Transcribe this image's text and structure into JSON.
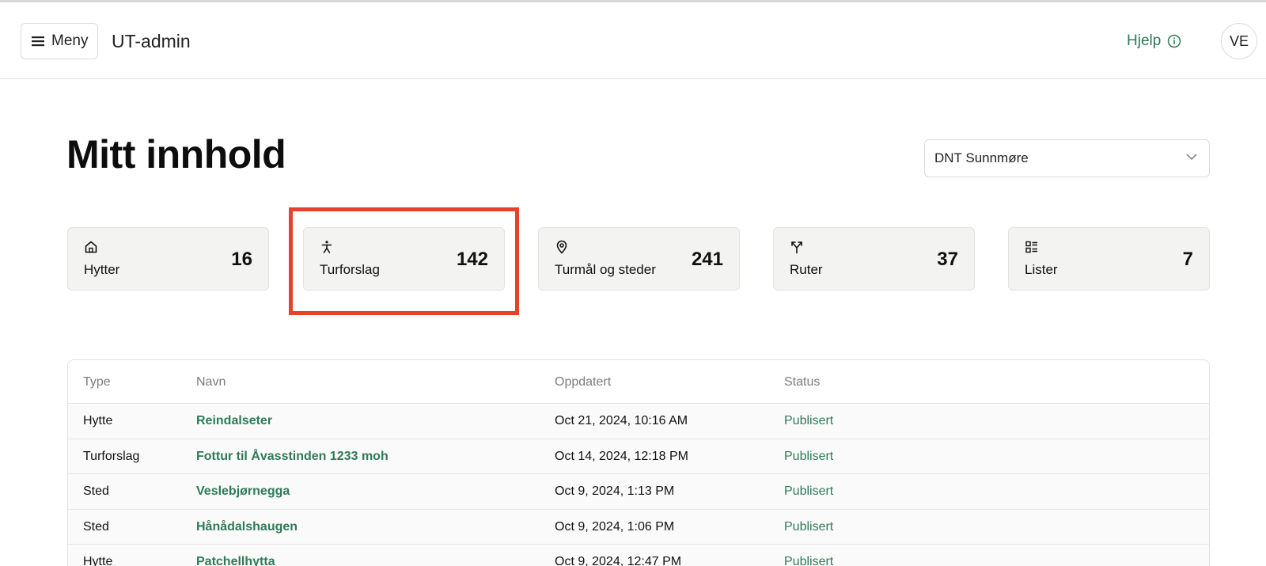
{
  "header": {
    "menu_label": "Meny",
    "app_title": "UT-admin",
    "help_label": "Hjelp",
    "avatar_initials": "VE"
  },
  "page": {
    "title": "Mitt innhold",
    "org_select_value": "DNT Sunnmøre"
  },
  "cards": [
    {
      "icon": "house-icon",
      "label": "Hytter",
      "count": "16"
    },
    {
      "icon": "person-walking-icon",
      "label": "Turforslag",
      "count": "142"
    },
    {
      "icon": "map-pin-icon",
      "label": "Turmål og steder",
      "count": "241"
    },
    {
      "icon": "route-split-icon",
      "label": "Ruter",
      "count": "37"
    },
    {
      "icon": "list-icon",
      "label": "Lister",
      "count": "7"
    }
  ],
  "table": {
    "columns": {
      "type": "Type",
      "name": "Navn",
      "updated": "Oppdatert",
      "status": "Status"
    },
    "rows": [
      {
        "type": "Hytte",
        "name": "Reindalseter",
        "updated": "Oct 21, 2024, 10:16 AM",
        "status": "Publisert"
      },
      {
        "type": "Turforslag",
        "name": "Fottur til Åvasstinden 1233 moh",
        "updated": "Oct 14, 2024, 12:18 PM",
        "status": "Publisert"
      },
      {
        "type": "Sted",
        "name": "Veslebjørnegga",
        "updated": "Oct 9, 2024, 1:13 PM",
        "status": "Publisert"
      },
      {
        "type": "Sted",
        "name": "Hånådalshaugen",
        "updated": "Oct 9, 2024, 1:06 PM",
        "status": "Publisert"
      },
      {
        "type": "Hytte",
        "name": "Patchellhytta",
        "updated": "Oct 9, 2024, 12:47 PM",
        "status": "Publisert"
      }
    ]
  },
  "colors": {
    "accent_green": "#2f7a57",
    "highlight_red": "#e8402a",
    "card_bg": "#f3f3f2"
  }
}
